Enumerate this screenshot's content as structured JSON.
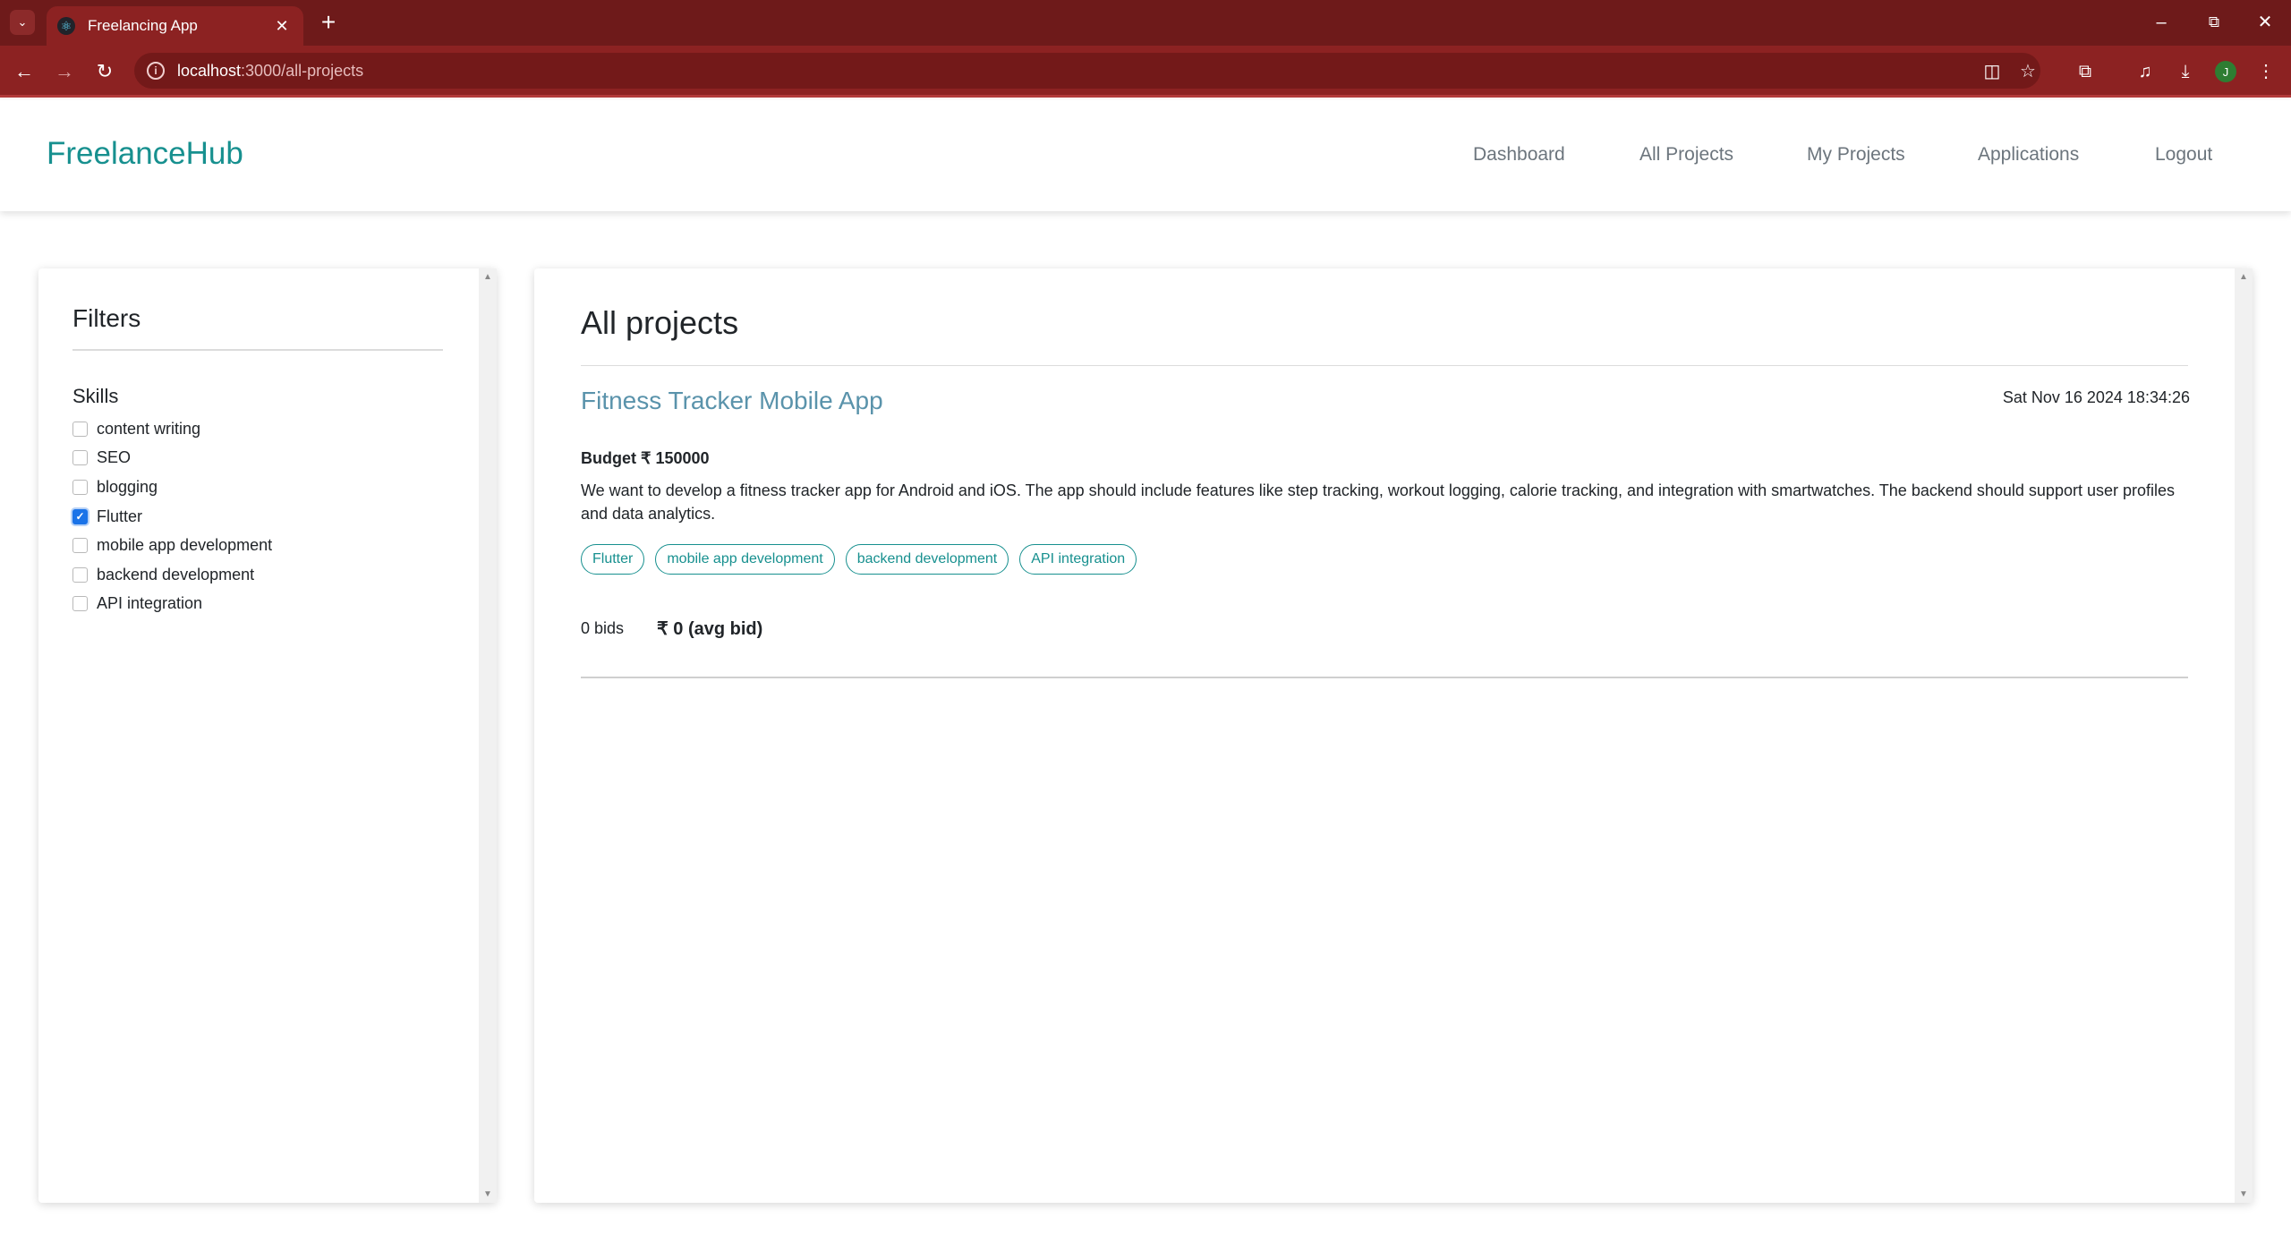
{
  "browser": {
    "tab_title": "Freelancing App",
    "url_host": "localhost",
    "url_path": ":3000/all-projects",
    "profile_initial": "J"
  },
  "app": {
    "brand": "FreelanceHub",
    "nav": [
      "Dashboard",
      "All Projects",
      "My Projects",
      "Applications",
      "Logout"
    ]
  },
  "filters": {
    "title": "Filters",
    "skills_title": "Skills",
    "skills": [
      {
        "label": "content writing",
        "checked": false
      },
      {
        "label": "SEO",
        "checked": false
      },
      {
        "label": "blogging",
        "checked": false
      },
      {
        "label": "Flutter",
        "checked": true
      },
      {
        "label": "mobile app development",
        "checked": false
      },
      {
        "label": "backend development",
        "checked": false
      },
      {
        "label": "API integration",
        "checked": false
      }
    ]
  },
  "projects": {
    "title": "All projects",
    "items": [
      {
        "title": "Fitness Tracker Mobile App",
        "date": "Sat Nov 16 2024 18:34:26",
        "budget": "Budget ₹ 150000",
        "description": "We want to develop a fitness tracker app for Android and iOS. The app should include features like step tracking, workout logging, calorie tracking, and integration with smartwatches. The backend should support user profiles and data analytics.",
        "tags": [
          "Flutter",
          "mobile app development",
          "backend development",
          "API integration"
        ],
        "bids": "0 bids",
        "avg_bid": "₹ 0 (avg bid)"
      }
    ]
  },
  "colors": {
    "brand": "#17908f",
    "project_title": "#5a93ab",
    "browser_frame": "#8c2222",
    "checkbox_checked": "#1a73e8"
  }
}
